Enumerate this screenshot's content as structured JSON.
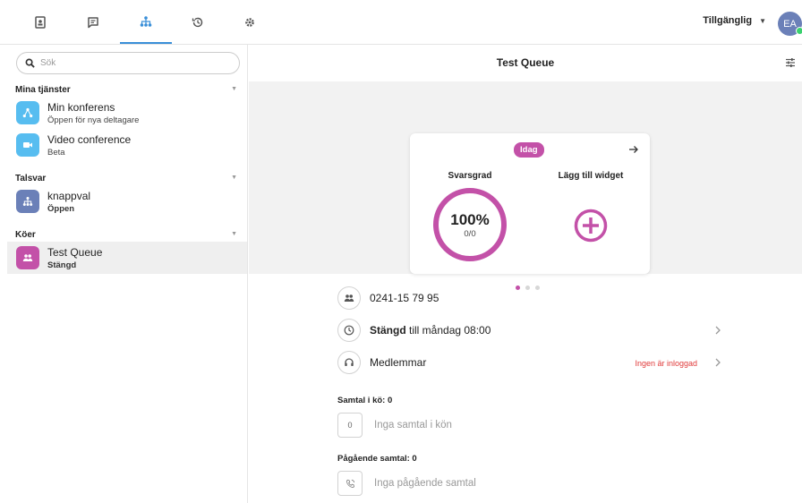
{
  "header": {
    "tabs": [
      {
        "icon": "contacts-icon"
      },
      {
        "icon": "chat-icon"
      },
      {
        "icon": "org-chart-icon",
        "active": true
      },
      {
        "icon": "history-icon"
      },
      {
        "icon": "gear-icon"
      }
    ],
    "status_label": "Tillgänglig",
    "avatar_initials": "EA",
    "presence_color": "#3bd16f"
  },
  "sidebar": {
    "search_placeholder": "Sök",
    "sections": [
      {
        "title": "Mina tjänster",
        "items": [
          {
            "title": "Min konferens",
            "subtitle": "Öppen för nya deltagare",
            "icon": "conference-icon",
            "color": "#57bdf0"
          },
          {
            "title": "Video conference",
            "subtitle": "Beta",
            "icon": "video-camera-icon",
            "color": "#57bdf0"
          }
        ]
      },
      {
        "title": "Talsvar",
        "items": [
          {
            "title": "knappval",
            "subtitle": "Öppen",
            "icon": "org-chart-icon",
            "color": "#6b80b8"
          }
        ]
      },
      {
        "title": "Köer",
        "items": [
          {
            "title": "Test Queue",
            "subtitle": "Stängd",
            "icon": "people-icon",
            "color": "#c351a8",
            "selected": true
          }
        ]
      }
    ]
  },
  "main": {
    "title": "Test Queue",
    "widget": {
      "badge": "Idag",
      "metric_label": "Svarsgrad",
      "metric_value": "100%",
      "metric_fraction": "0/0",
      "add_label": "Lägg till widget",
      "accent": "#c351a8",
      "pages": 3,
      "active_page": 0
    },
    "info": {
      "phone": "0241-15 79 95",
      "hours_status": "Stängd",
      "hours_rest": " till måndag 08:00",
      "members_label": "Medlemmar",
      "members_warning": "Ingen är inloggad"
    },
    "queue": {
      "label": "Samtal i kö: 0",
      "box": "0",
      "empty": "Inga samtal i kön"
    },
    "ongoing": {
      "label": "Pågående samtal: 0",
      "empty": "Inga pågående samtal"
    }
  }
}
